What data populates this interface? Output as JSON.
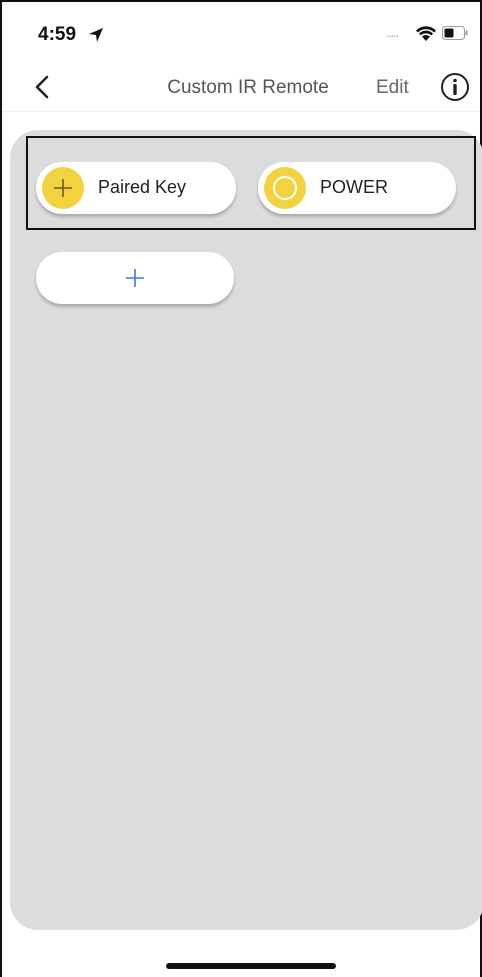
{
  "status_bar": {
    "time": "4:59",
    "icons": [
      "location-arrow-icon",
      "signal-dots-icon",
      "wifi-icon",
      "battery-icon"
    ],
    "signal_dots": "....."
  },
  "nav": {
    "title": "Custom IR Remote",
    "edit_label": "Edit",
    "icons": [
      "back-chevron-icon",
      "info-icon"
    ]
  },
  "keys": [
    {
      "label": "Paired Key",
      "icon": "plus-icon",
      "color": "#f2d33f"
    },
    {
      "label": "POWER",
      "icon": "ring-icon",
      "color": "#f2d33f"
    }
  ],
  "add_button": {
    "icon": "plus-icon",
    "color": "#3b7bd6"
  },
  "colors": {
    "accent_yellow": "#f2d33f",
    "panel_gray": "#dcdcdc",
    "add_blue": "#3b7bd6"
  }
}
